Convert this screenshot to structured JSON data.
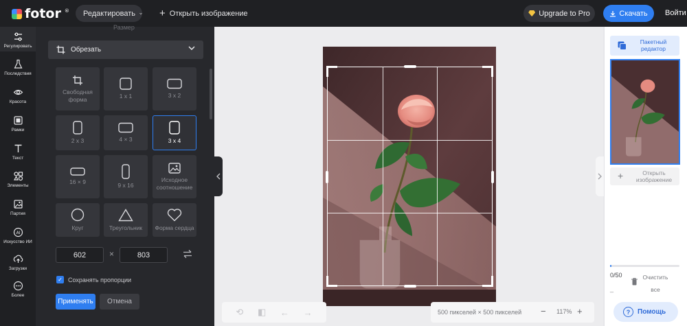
{
  "header": {
    "logo_text": "fotor",
    "logo_sup": "®",
    "edit_dropdown": "Редактировать",
    "open_image": "Открыть изображение",
    "upgrade": "Upgrade to Pro",
    "download": "Скачать",
    "login": "Войти"
  },
  "leftrail": {
    "items": [
      {
        "label": "Регулировать",
        "icon": "sliders-icon"
      },
      {
        "label": "Последствия",
        "icon": "flask-icon"
      },
      {
        "label": "Красота",
        "icon": "eye-icon"
      },
      {
        "label": "Рамки",
        "icon": "frame-icon"
      },
      {
        "label": "Текст",
        "icon": "text-icon"
      },
      {
        "label": "Элементы",
        "icon": "shapes-icon"
      },
      {
        "label": "Партия",
        "icon": "image-stack-icon"
      },
      {
        "label": "Искусство ИИ",
        "icon": "ai-icon"
      },
      {
        "label": "Загрузки",
        "icon": "upload-icon"
      },
      {
        "label": "Более",
        "icon": "more-icon"
      }
    ]
  },
  "panel": {
    "size_label": "Размер",
    "crop_label": "Обрезать",
    "presets": [
      {
        "label": "Свободная форма",
        "icon": "crop-icon"
      },
      {
        "label": "1 x 1",
        "icon": "square-icon"
      },
      {
        "label": "3 x 2",
        "icon": "landscape-rect-icon"
      },
      {
        "label": "2 x 3",
        "icon": "portrait-rect-icon"
      },
      {
        "label": "4 × 3",
        "icon": "landscape-rect-icon"
      },
      {
        "label": "3 x 4",
        "icon": "portrait-rect-icon"
      },
      {
        "label": "16 × 9",
        "icon": "wide-rect-icon"
      },
      {
        "label": "9 x 16",
        "icon": "tall-rect-icon"
      },
      {
        "label": "Исходное соотношение",
        "icon": "image-icon"
      },
      {
        "label": "Круг",
        "icon": "circle-icon"
      },
      {
        "label": "Треугольник",
        "icon": "triangle-icon"
      },
      {
        "label": "Форма сердца",
        "icon": "heart-icon"
      }
    ],
    "selected_preset": "3 x 4",
    "width": "602",
    "height": "803",
    "times": "×",
    "keep_ratio": "Сохранять пропорции",
    "apply": "Применять",
    "cancel": "Отмена"
  },
  "canvas": {
    "info": "500 пикселей × 500 пикселей",
    "zoom": "117%",
    "zoom_minus": "−",
    "zoom_plus": "+"
  },
  "rightpanel": {
    "batch_editor": "Пакетный редактор",
    "open_image": "Открыть изображение",
    "count": "0/50",
    "count_dash": "_",
    "clear": "Очистить все",
    "help": "Помощь",
    "progress": 0.02
  },
  "colors": {
    "accent": "#2f7ef0",
    "topbar": "#1f2023",
    "panel": "#27282c"
  }
}
